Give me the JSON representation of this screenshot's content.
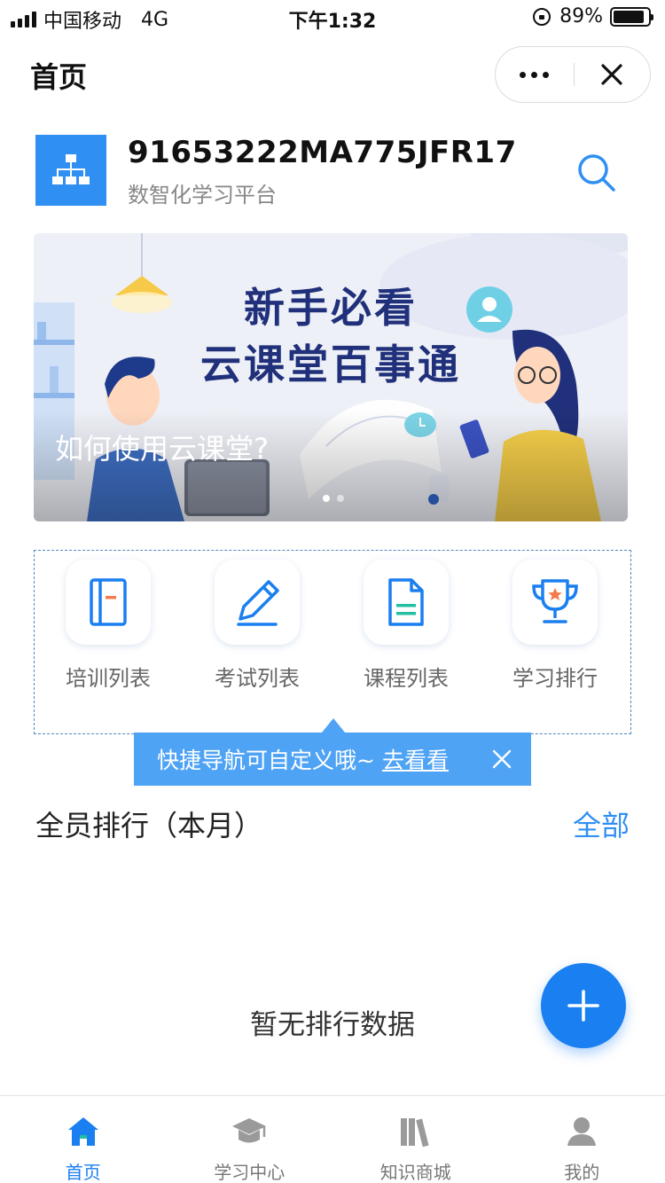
{
  "status_bar": {
    "carrier": "中国移动",
    "network": "4G",
    "time": "下午1:32",
    "battery_percent": "89%",
    "battery_level": 0.89
  },
  "nav": {
    "title": "首页",
    "more_icon": "more-dots-icon",
    "close_icon": "close-icon"
  },
  "org": {
    "code": "91653222MA775JFR17",
    "subtitle": "数智化学习平台",
    "logo_icon": "org-chart-icon",
    "search_icon": "search-icon"
  },
  "banner": {
    "title_line1": "新手必看",
    "title_line2": "云课堂百事通",
    "caption": "如何使用云课堂?",
    "slide_count": 2,
    "active_slide": 1
  },
  "quick_nav": {
    "items": [
      {
        "label": "培训列表",
        "icon": "training-book-icon"
      },
      {
        "label": "考试列表",
        "icon": "pencil-icon"
      },
      {
        "label": "课程列表",
        "icon": "document-icon"
      },
      {
        "label": "学习排行",
        "icon": "trophy-icon"
      }
    ]
  },
  "tooltip": {
    "text": "快捷导航可自定义哦~",
    "link": "去看看"
  },
  "ranking": {
    "title": "全员排行（本月）",
    "all_link": "全部",
    "empty_text": "暂无排行数据"
  },
  "fab": {
    "icon": "plus-icon"
  },
  "tabbar": {
    "tabs": [
      {
        "label": "首页",
        "icon": "home-icon",
        "active": true
      },
      {
        "label": "学习中心",
        "icon": "graduation-cap-icon",
        "active": false
      },
      {
        "label": "知识商城",
        "icon": "books-icon",
        "active": false
      },
      {
        "label": "我的",
        "icon": "user-icon",
        "active": false
      }
    ]
  },
  "colors": {
    "primary": "#1a7ff0",
    "tooltip_bg": "#4fa3f5",
    "banner_title": "#20307a"
  }
}
